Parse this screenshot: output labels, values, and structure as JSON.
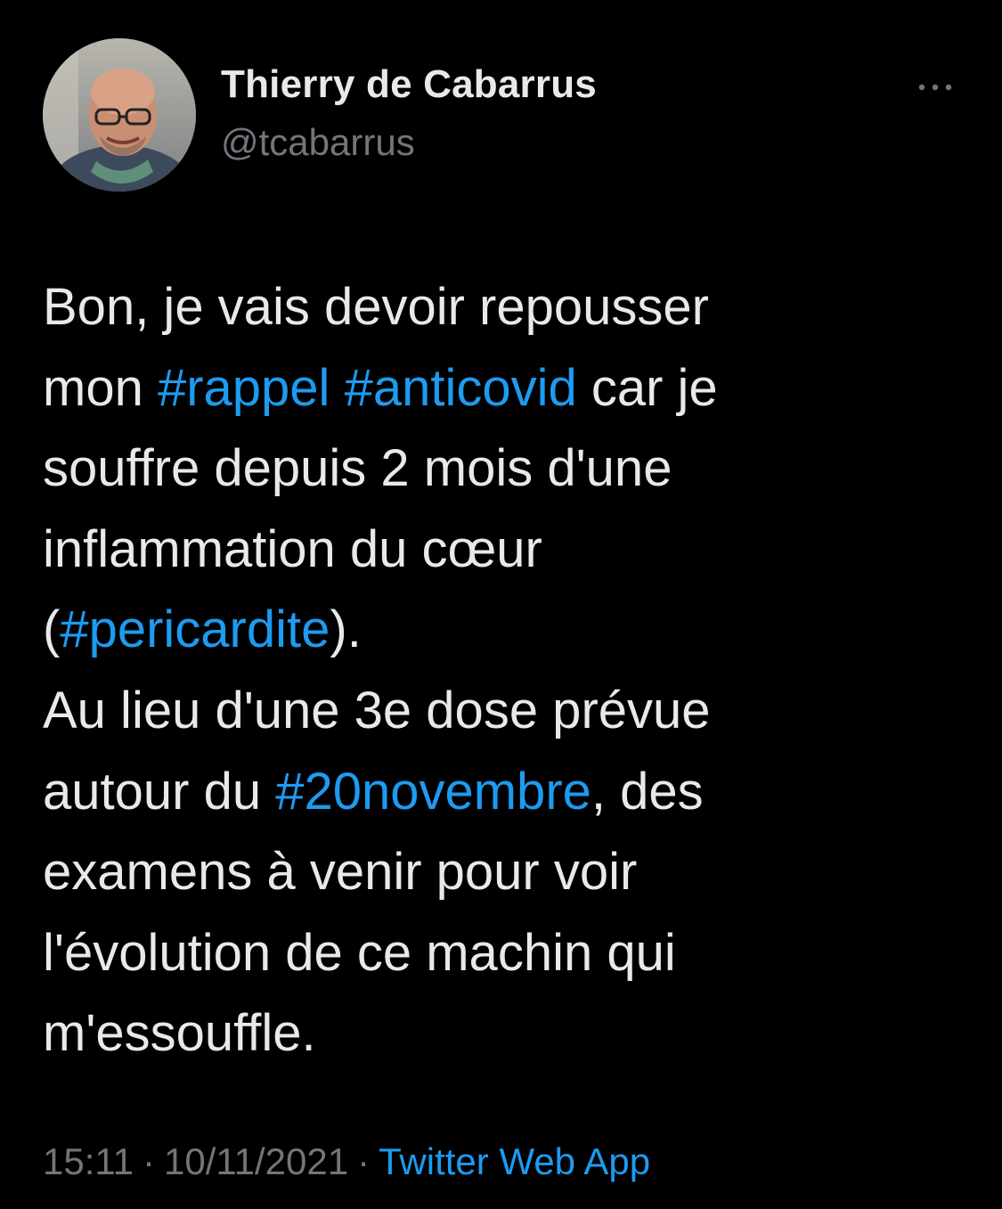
{
  "author": {
    "name": "Thierry de Cabarrus",
    "handle": "@tcabarrus"
  },
  "icons": {
    "more": "more-horizontal-icon",
    "avatar": "profile-photo"
  },
  "tweet": {
    "lines": [
      [
        {
          "t": "Bon, je vais devoir repousser"
        }
      ],
      [
        {
          "t": "mon "
        },
        {
          "t": "#rappel",
          "tag": true
        },
        {
          "t": " "
        },
        {
          "t": "#anticovid",
          "tag": true
        },
        {
          "t": " car je"
        }
      ],
      [
        {
          "t": "souffre depuis 2 mois d'une"
        }
      ],
      [
        {
          "t": "inflammation du cœur"
        }
      ],
      [
        {
          "t": "("
        },
        {
          "t": "#pericardite",
          "tag": true
        },
        {
          "t": ")."
        }
      ],
      [
        {
          "t": "Au lieu d'une 3e dose prévue"
        }
      ],
      [
        {
          "t": "autour du "
        },
        {
          "t": "#20novembre",
          "tag": true
        },
        {
          "t": ", des"
        }
      ],
      [
        {
          "t": "examens à venir pour voir"
        }
      ],
      [
        {
          "t": "l'évolution de ce machin qui"
        }
      ],
      [
        {
          "t": "m'essouffle."
        }
      ]
    ]
  },
  "meta": {
    "time": "15:11",
    "separator": "·",
    "date": "10/11/2021",
    "source": "Twitter Web App"
  },
  "colors": {
    "background": "#000000",
    "text": "#e7e9ea",
    "secondary": "#71767b",
    "link": "#1d9bf0"
  }
}
